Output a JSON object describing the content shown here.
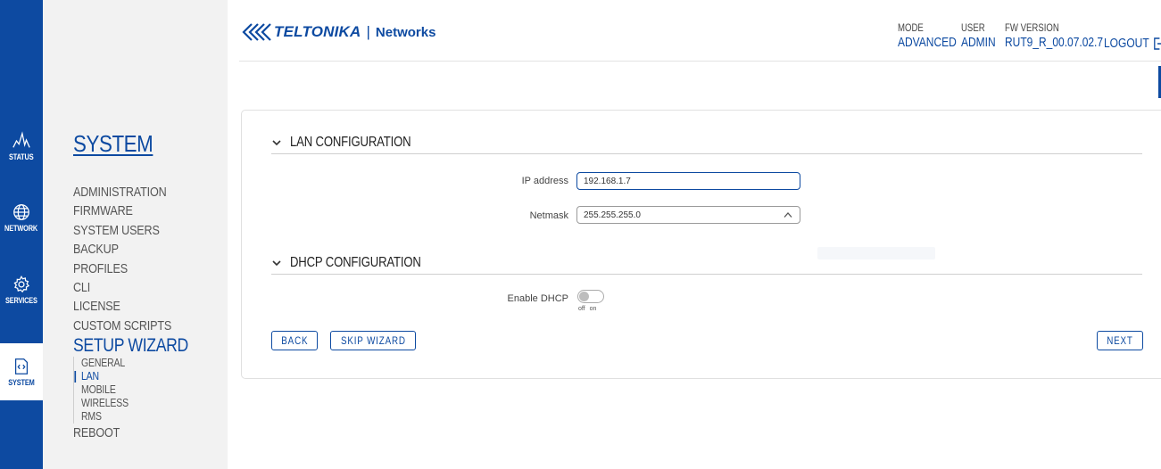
{
  "rail": {
    "items": [
      {
        "label": "STATUS",
        "icon": "status-pulse-icon"
      },
      {
        "label": "NETWORK",
        "icon": "globe-icon"
      },
      {
        "label": "SERVICES",
        "icon": "gear-icon"
      },
      {
        "label": "SYSTEM",
        "icon": "code-file-icon"
      }
    ]
  },
  "sidebar": {
    "title": "SYSTEM",
    "items": [
      "ADMINISTRATION",
      "FIRMWARE",
      "SYSTEM USERS",
      "BACKUP",
      "PROFILES",
      "CLI",
      "LICENSE",
      "CUSTOM SCRIPTS"
    ],
    "active": "SETUP WIZARD",
    "subitems": [
      "GENERAL",
      "LAN",
      "MOBILE",
      "WIRELESS",
      "RMS"
    ],
    "last": "REBOOT"
  },
  "header": {
    "brand": "TELTONIKA",
    "separator": "|",
    "product": "Networks",
    "mode_label": "MODE",
    "mode_value": "ADVANCED",
    "user_label": "USER",
    "user_value": "ADMIN",
    "fw_label": "FW VERSION",
    "fw_value": "RUT9_R_00.07.02.7",
    "logout": "LOGOUT"
  },
  "lan": {
    "title": "LAN CONFIGURATION",
    "ip_label": "IP address",
    "ip_value": "192.168.1.7",
    "netmask_label": "Netmask",
    "netmask_value": "255.255.255.0"
  },
  "dhcp": {
    "title": "DHCP CONFIGURATION",
    "enable_label": "Enable DHCP",
    "off": "off",
    "on": "on"
  },
  "buttons": {
    "back": "BACK",
    "skip": "SKIP WIZARD",
    "next": "NEXT"
  },
  "colors": {
    "accent": "#0d4aa1",
    "sidebar_bg": "#f2f2f2"
  }
}
